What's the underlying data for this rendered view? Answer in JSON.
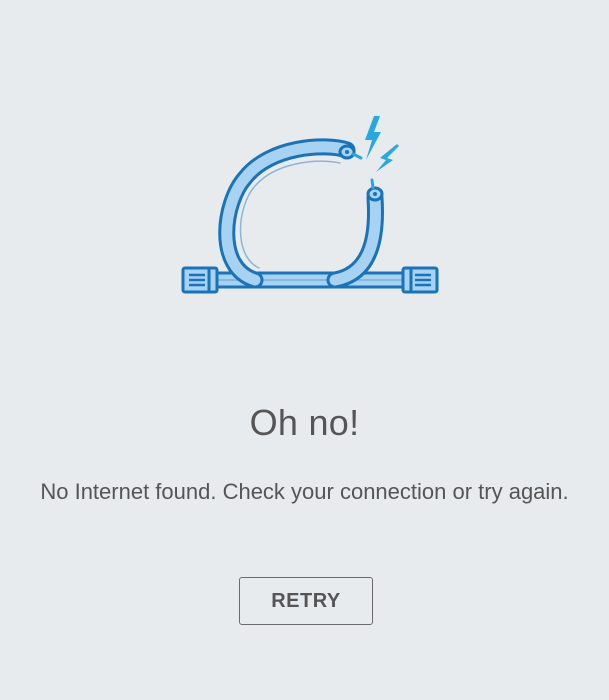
{
  "empty_state": {
    "illustration_icon": "broken-cable-icon",
    "title": "Oh no!",
    "message": "No Internet found. Check your connection or try again.",
    "retry_label": "RETRY"
  },
  "colors": {
    "background": "#e8ebee",
    "text": "#555555",
    "cable_fill": "#a8d2f1",
    "cable_stroke": "#1a73b8",
    "spark": "#27a8e0",
    "button_border": "#6b6b6b"
  }
}
